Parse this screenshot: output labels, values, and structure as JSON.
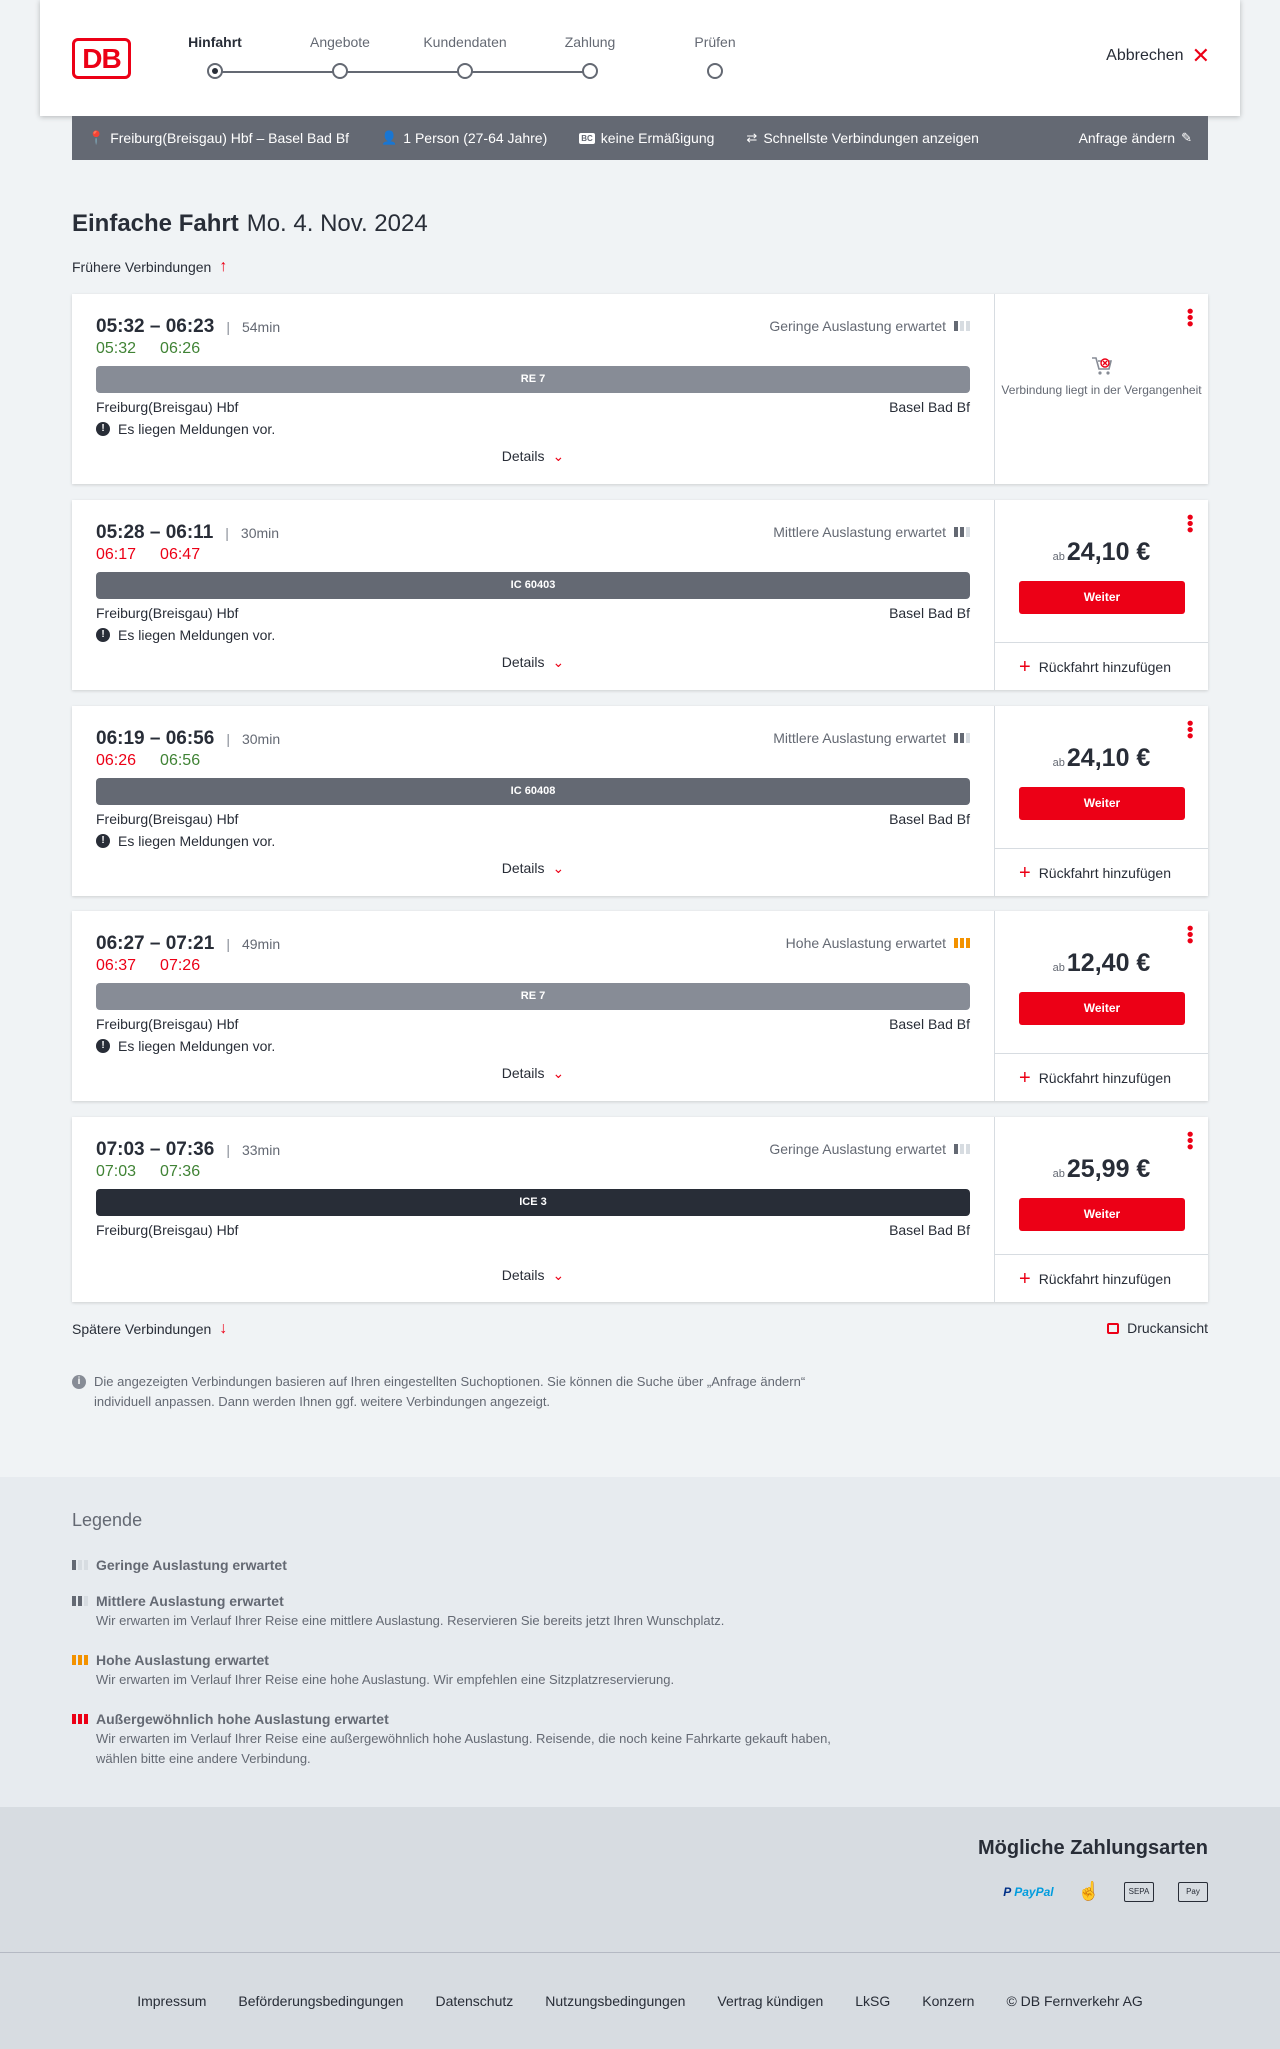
{
  "header": {
    "logo": "DB",
    "steps": [
      "Hinfahrt",
      "Angebote",
      "Kundendaten",
      "Zahlung",
      "Prüfen"
    ],
    "active_step": "Hinfahrt",
    "abort_label": "Abbrechen"
  },
  "infobar": {
    "route": "Freiburg(Breisgau) Hbf – Basel Bad Bf",
    "persons": "1 Person (27-64 Jahre)",
    "bc_badge": "BC",
    "discount": "keine Ermäßigung",
    "fastest": "Schnellste Verbindungen anzeigen",
    "edit": "Anfrage ändern"
  },
  "title": {
    "bold": "Einfache Fahrt",
    "date": "Mo. 4. Nov. 2024"
  },
  "earlier_label": "Frühere Verbindungen",
  "later_label": "Spätere Verbindungen",
  "print_label": "Druckansicht",
  "details_label": "Details",
  "weiter_label": "Weiter",
  "return_label": "Rückfahrt hinzufügen",
  "price_prefix": "ab",
  "past_label": "Verbindung liegt in der Vergangenheit",
  "message_label": "Es liegen Meldungen vor.",
  "connections": [
    {
      "times": "05:32 – 06:23",
      "duration": "54min",
      "rt_dep": "05:32",
      "rt_arr": "06:26",
      "dep_color": "green",
      "arr_color": "green",
      "load": "Geringe Auslastung erwartet",
      "load_level": 1,
      "train": "RE 7",
      "train_color": "#878c96",
      "from": "Freiburg(Breisgau) Hbf",
      "to": "Basel Bad Bf",
      "has_message": true,
      "price": null,
      "past": true
    },
    {
      "times": "05:28 – 06:11",
      "duration": "30min",
      "rt_dep": "06:17",
      "rt_arr": "06:47",
      "dep_color": "red",
      "arr_color": "red",
      "load": "Mittlere Auslastung erwartet",
      "load_level": 2,
      "train": "IC 60403",
      "train_color": "#646973",
      "from": "Freiburg(Breisgau) Hbf",
      "to": "Basel Bad Bf",
      "has_message": true,
      "price": "24,10 €",
      "past": false
    },
    {
      "times": "06:19 – 06:56",
      "duration": "30min",
      "rt_dep": "06:26",
      "rt_arr": "06:56",
      "dep_color": "red",
      "arr_color": "green",
      "load": "Mittlere Auslastung erwartet",
      "load_level": 2,
      "train": "IC 60408",
      "train_color": "#646973",
      "from": "Freiburg(Breisgau) Hbf",
      "to": "Basel Bad Bf",
      "has_message": true,
      "price": "24,10 €",
      "past": false
    },
    {
      "times": "06:27 – 07:21",
      "duration": "49min",
      "rt_dep": "06:37",
      "rt_arr": "07:26",
      "dep_color": "red",
      "arr_color": "red",
      "load": "Hohe Auslastung erwartet",
      "load_level": 3,
      "train": "RE 7",
      "train_color": "#878c96",
      "from": "Freiburg(Breisgau) Hbf",
      "to": "Basel Bad Bf",
      "has_message": true,
      "price": "12,40 €",
      "past": false
    },
    {
      "times": "07:03 – 07:36",
      "duration": "33min",
      "rt_dep": "07:03",
      "rt_arr": "07:36",
      "dep_color": "green",
      "arr_color": "green",
      "load": "Geringe Auslastung erwartet",
      "load_level": 1,
      "train": "ICE 3",
      "train_color": "#282d37",
      "from": "Freiburg(Breisgau) Hbf",
      "to": "Basel Bad Bf",
      "has_message": false,
      "price": "25,99 €",
      "past": false
    }
  ],
  "note": "Die angezeigten Verbindungen basieren auf Ihren eingestellten Suchoptionen. Sie können die Suche über „Anfrage ändern“ individuell anpassen. Dann werden Ihnen ggf. weitere Verbindungen angezeigt.",
  "legend": {
    "title": "Legende",
    "items": [
      {
        "title": "Geringe Auslastung erwartet",
        "text": ""
      },
      {
        "title": "Mittlere Auslastung erwartet",
        "text": "Wir erwarten im Verlauf Ihrer Reise eine mittlere Auslastung. Reservieren Sie bereits jetzt Ihren Wunschplatz."
      },
      {
        "title": "Hohe Auslastung erwartet",
        "text": "Wir erwarten im Verlauf Ihrer Reise eine hohe Auslastung. Wir empfehlen eine Sitzplatzreservierung."
      },
      {
        "title": "Außergewöhnlich hohe Auslastung erwartet",
        "text": "Wir erwarten im Verlauf Ihrer Reise eine außergewöhnlich hohe Auslastung. Reisende, die noch keine Fahrkarte gekauft haben, wählen bitte eine andere Verbindung."
      }
    ]
  },
  "payment": {
    "title": "Mögliche Zahlungsarten",
    "paypal": "Pay",
    "paypal2": "Pal",
    "sepa": "SEPA",
    "applepay": " Pay"
  },
  "footer": [
    "Impressum",
    "Beförderungsbedingungen",
    "Datenschutz",
    "Nutzungsbedingungen",
    "Vertrag kündigen",
    "LkSG",
    "Konzern",
    "© DB Fernverkehr AG"
  ],
  "colors": {
    "accent": "#ec0016",
    "green": "#408335",
    "orange": "#f39200"
  }
}
